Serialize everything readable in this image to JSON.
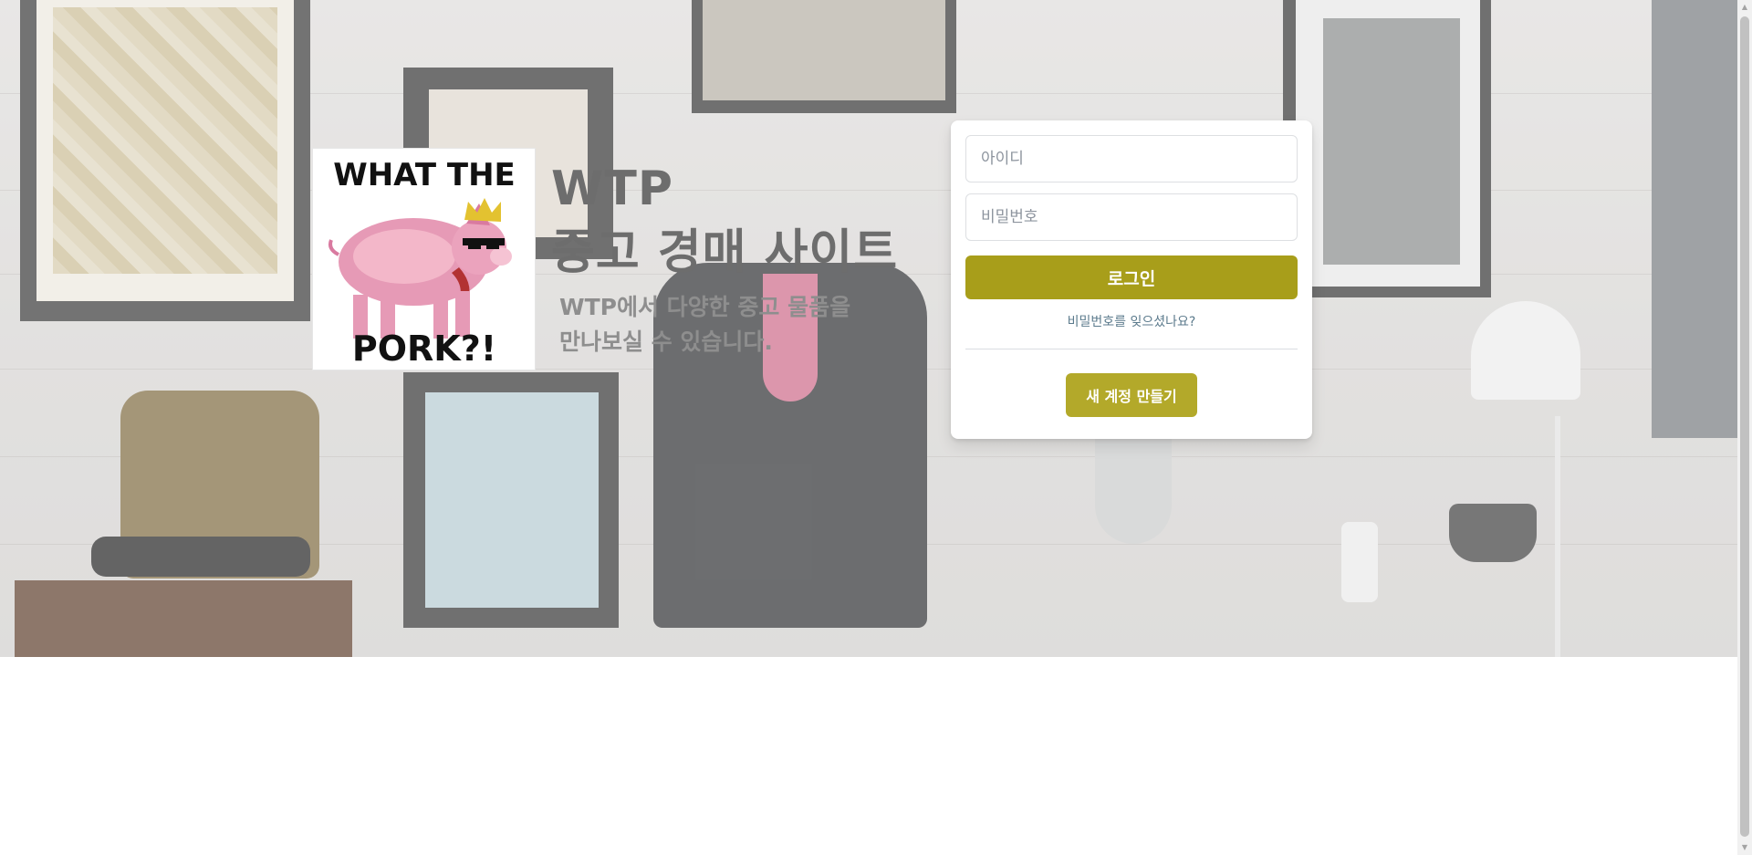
{
  "brand": {
    "logo_icon": "what-the-pork-pig-logo",
    "logo_text_top": "WHAT THE",
    "logo_text_bottom": "PORK?!",
    "title_line1": "WTP",
    "title_line2": "중고 경매 사이트",
    "subtitle_line1": "WTP에서 다양한 중고 물품을",
    "subtitle_line2": "만나보실 수 있습니다."
  },
  "login": {
    "id_placeholder": "아이디",
    "id_value": "",
    "password_placeholder": "비밀번호",
    "password_value": "",
    "login_button": "로그인",
    "forgot_link": "비밀번호를 잊으셨나요?",
    "create_button": "새 계정 만들기"
  },
  "colors": {
    "accent": "#a89e1a",
    "accent_light": "#b3a92a",
    "link": "#5b7a8c",
    "title_text": "#6d6d6d"
  },
  "scrollbar": {
    "up_icon": "arrow-up-icon",
    "down_icon": "arrow-down-icon"
  }
}
